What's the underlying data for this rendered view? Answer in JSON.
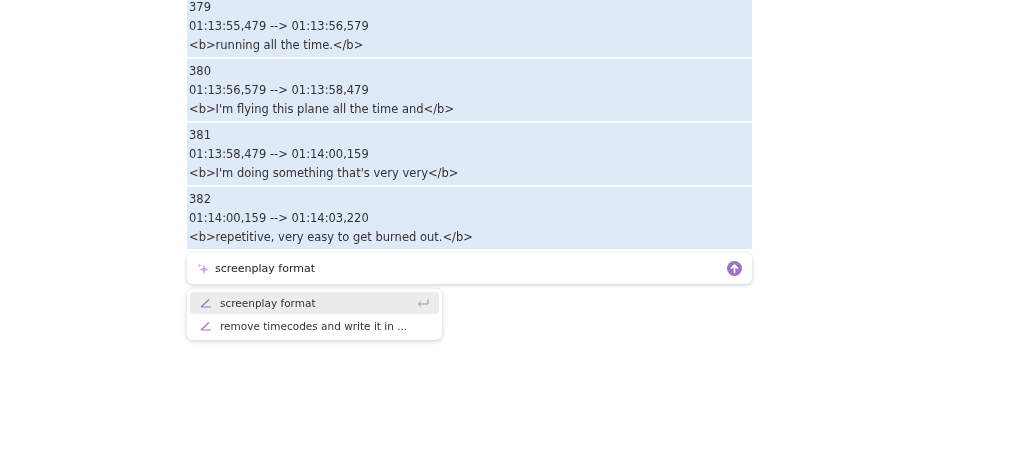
{
  "subtitles": [
    {
      "index": "379",
      "timecode": "01:13:55,479 --> 01:13:56,579",
      "text": "<b>running all the time.</b>"
    },
    {
      "index": "380",
      "timecode": "01:13:56,579 --> 01:13:58,479",
      "text": "<b>I'm flying this plane all the time and</b>"
    },
    {
      "index": "381",
      "timecode": "01:13:58,479 --> 01:14:00,159",
      "text": "<b>I'm doing something that's very very</b>"
    },
    {
      "index": "382",
      "timecode": "01:14:00,159 --> 01:14:03,220",
      "text": "<b>repetitive, very easy to get burned out.</b>"
    }
  ],
  "prompt": {
    "value": "screenplay format"
  },
  "suggestions": [
    {
      "label": "screenplay format",
      "selected": true
    },
    {
      "label": "remove timecodes and write it in ...",
      "selected": false
    }
  ]
}
